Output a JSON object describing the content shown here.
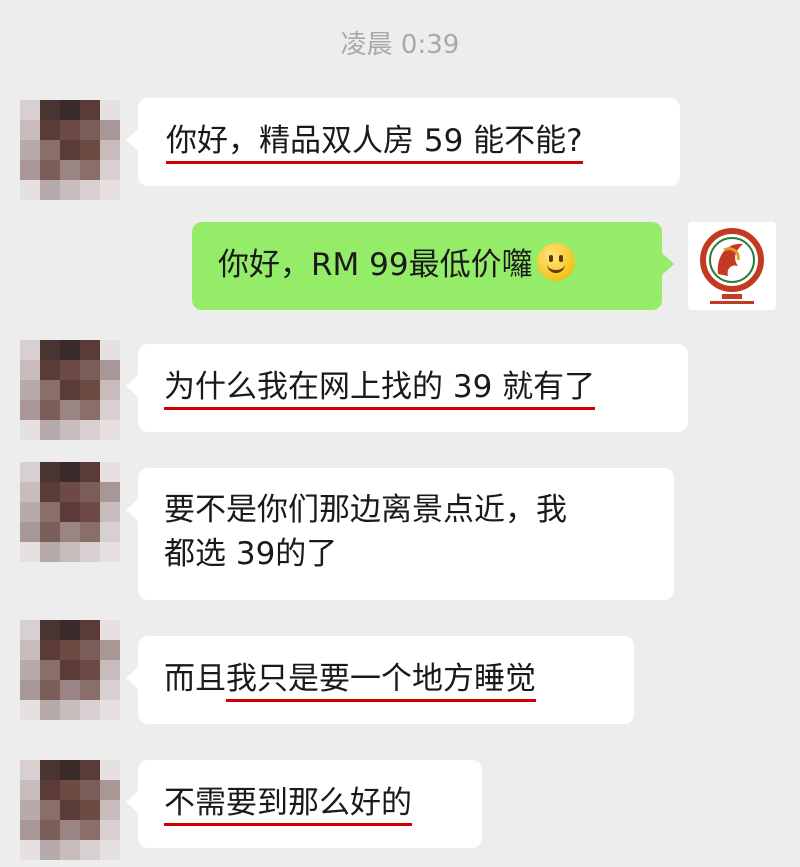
{
  "timestamp": "凌晨 0:39",
  "colors": {
    "background": "#ededed",
    "incoming_bubble": "#ffffff",
    "outgoing_bubble": "#95ec69",
    "underline": "#d40000"
  },
  "contact_avatar": {
    "icon": "pixelated-avatar-icon"
  },
  "my_avatar": {
    "icon": "hotel-logo-icon"
  },
  "messages": [
    {
      "direction": "in",
      "parts": [
        {
          "text": "你好，精品双人房 59 能不能?",
          "underline": true
        }
      ]
    },
    {
      "direction": "out",
      "parts": [
        {
          "text": "你好，RM 99最低价囖",
          "underline": false
        }
      ],
      "emoji": "slight-smile-emoji"
    },
    {
      "direction": "in",
      "parts": [
        {
          "text": "为什么我在网上找的 39 就有了",
          "underline": true
        }
      ]
    },
    {
      "direction": "in",
      "lines": [
        "要不是你们那边离景点近，我",
        "都选 39的了"
      ]
    },
    {
      "direction": "in",
      "parts": [
        {
          "text": "而且",
          "underline": false
        },
        {
          "text": "我只是要一个地方睡觉",
          "underline": true
        }
      ]
    },
    {
      "direction": "in",
      "parts": [
        {
          "text": "不需要到那么好的",
          "underline": true
        }
      ]
    }
  ]
}
